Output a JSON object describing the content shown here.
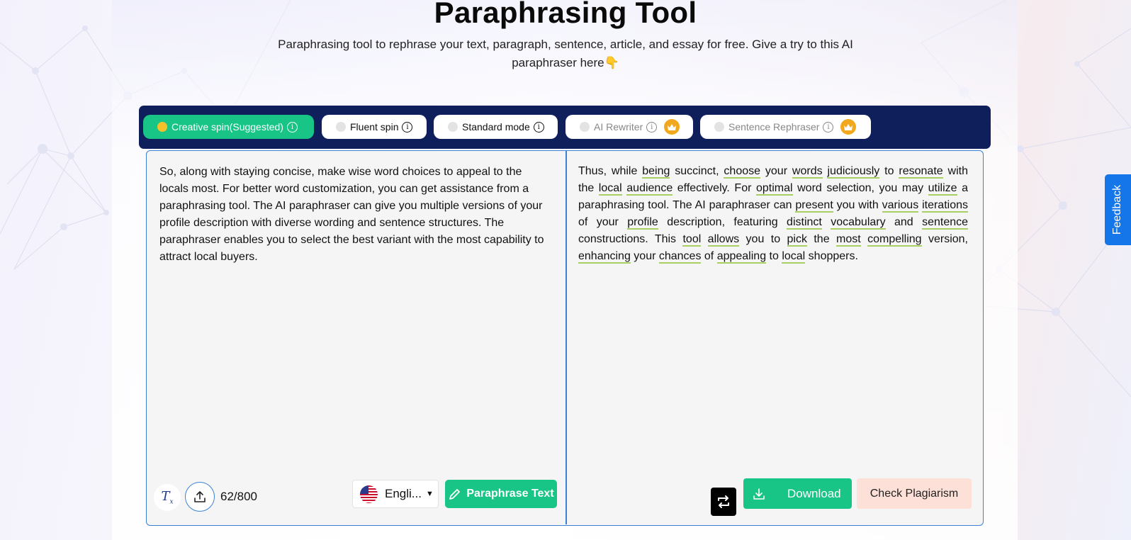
{
  "page": {
    "title": "Paraphrasing Tool",
    "subtitle": "Paraphrasing tool to rephrase your text, paragraph, sentence, article, and essay for free. Give a try to this AI paraphraser here👇"
  },
  "modes": [
    {
      "label": "Creative spin(Suggested)",
      "active": true,
      "premium": false
    },
    {
      "label": "Fluent spin",
      "active": false,
      "premium": false
    },
    {
      "label": "Standard mode",
      "active": false,
      "premium": false
    },
    {
      "label": "AI Rewriter",
      "active": false,
      "premium": true
    },
    {
      "label": "Sentence Rephraser",
      "active": false,
      "premium": true
    }
  ],
  "input": {
    "text": "So, along with staying concise, make wise word choices to appeal to the locals most. For better word customization, you can get assistance from a paraphrasing tool. The AI paraphraser can give you multiple versions of your profile description with diverse wording and sentence structures. The paraphraser enables you to select the best variant with the most capability to attract local buyers.",
    "word_count": "62/800",
    "language": "Engli...",
    "paraphrase_button": "Paraphrase Text"
  },
  "output": {
    "segments": [
      {
        "t": "Thus, while ",
        "h": false
      },
      {
        "t": "being",
        "h": true
      },
      {
        "t": " succinct, ",
        "h": false
      },
      {
        "t": "choose",
        "h": true
      },
      {
        "t": " your ",
        "h": false
      },
      {
        "t": "words",
        "h": true
      },
      {
        "t": " ",
        "h": false
      },
      {
        "t": "judiciously",
        "h": true
      },
      {
        "t": " to ",
        "h": false
      },
      {
        "t": "resonate",
        "h": true
      },
      {
        "t": " with the ",
        "h": false
      },
      {
        "t": "local",
        "h": true
      },
      {
        "t": " ",
        "h": false
      },
      {
        "t": "audience",
        "h": true
      },
      {
        "t": " effectively. For ",
        "h": false
      },
      {
        "t": "optimal",
        "h": true
      },
      {
        "t": " word selection, you may ",
        "h": false
      },
      {
        "t": "utilize",
        "h": true
      },
      {
        "t": " a paraphrasing tool. The AI paraphraser can ",
        "h": false
      },
      {
        "t": "present",
        "h": true
      },
      {
        "t": " you with ",
        "h": false
      },
      {
        "t": "various",
        "h": true
      },
      {
        "t": " ",
        "h": false
      },
      {
        "t": "iterations",
        "h": true
      },
      {
        "t": " of your ",
        "h": false
      },
      {
        "t": "profile",
        "h": true
      },
      {
        "t": " description, featuring ",
        "h": false
      },
      {
        "t": "distinct",
        "h": true
      },
      {
        "t": " ",
        "h": false
      },
      {
        "t": "vocabulary",
        "h": true
      },
      {
        "t": " and ",
        "h": false
      },
      {
        "t": "sentence",
        "h": true
      },
      {
        "t": " constructions. This ",
        "h": false
      },
      {
        "t": "tool",
        "h": true
      },
      {
        "t": " ",
        "h": false
      },
      {
        "t": "allows",
        "h": true
      },
      {
        "t": " you to ",
        "h": false
      },
      {
        "t": "pick",
        "h": true
      },
      {
        "t": " the ",
        "h": false
      },
      {
        "t": "most",
        "h": true
      },
      {
        "t": " ",
        "h": false
      },
      {
        "t": "compelling",
        "h": true
      },
      {
        "t": " version, ",
        "h": false
      },
      {
        "t": "enhancing",
        "h": true
      },
      {
        "t": " your ",
        "h": false
      },
      {
        "t": "chances",
        "h": true
      },
      {
        "t": " of ",
        "h": false
      },
      {
        "t": "appealing",
        "h": true
      },
      {
        "t": " to ",
        "h": false
      },
      {
        "t": "local",
        "h": true
      },
      {
        "t": " shoppers.",
        "h": false
      }
    ],
    "download_button": "Download",
    "plagiarism_button": "Check Plagiarism"
  },
  "feedback": {
    "label": "Feedback"
  },
  "icons": {
    "clear": "clear-format-icon",
    "upload": "upload-icon",
    "flag": "us-flag-icon",
    "pencil": "pencil-icon",
    "swap": "swap-icon",
    "download": "download-icon",
    "info": "info-icon",
    "crown": "crown-icon"
  },
  "colors": {
    "accent": "#19c487",
    "navy": "#0f1f5c",
    "border_blue": "#3b82d6",
    "highlight_underline": "#a8cf62",
    "crown": "#f2a81d",
    "feedback": "#1476e8",
    "plagiarism_bg": "#fde0d8"
  }
}
